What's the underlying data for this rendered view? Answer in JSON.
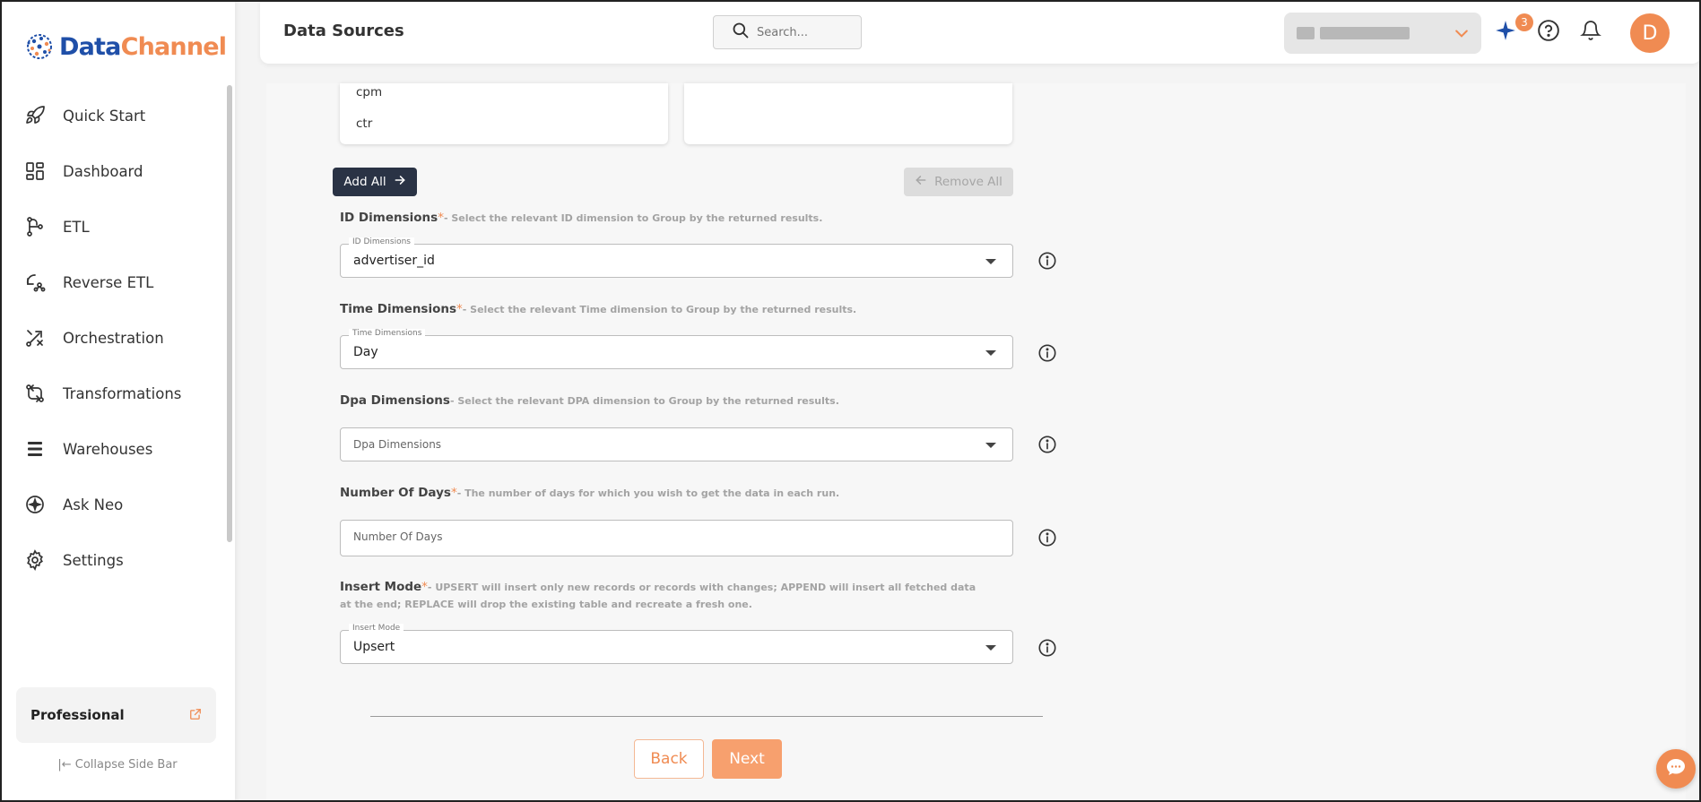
{
  "app": {
    "logo_part1": "Data",
    "logo_part2": "Channel",
    "brand_blue": "#1f4fa8",
    "accent": "#f08b52"
  },
  "sidebar": {
    "items": [
      {
        "label": "Quick Start",
        "icon": "rocket-icon"
      },
      {
        "label": "Dashboard",
        "icon": "dashboard-icon"
      },
      {
        "label": "ETL",
        "icon": "etl-icon"
      },
      {
        "label": "Reverse ETL",
        "icon": "reverse-etl-icon"
      },
      {
        "label": "Orchestration",
        "icon": "orchestration-icon"
      },
      {
        "label": "Transformations",
        "icon": "transformations-icon"
      },
      {
        "label": "Warehouses",
        "icon": "warehouses-icon"
      },
      {
        "label": "Ask Neo",
        "icon": "sparkle-icon"
      },
      {
        "label": "Settings",
        "icon": "gear-icon"
      }
    ],
    "plan_label": "Professional",
    "collapse_label": "Collapse Side Bar"
  },
  "header": {
    "title": "Data Sources",
    "search_placeholder": "Search...",
    "notifications_badge": "3",
    "avatar_initial": "D"
  },
  "metrics_list": {
    "available": [
      "cpm",
      "ctr"
    ]
  },
  "buttons": {
    "add_all": "Add All",
    "remove_all": "Remove All",
    "back": "Back",
    "next": "Next"
  },
  "fields": {
    "id_dimensions": {
      "title": "ID Dimensions",
      "required": "*",
      "hint": "- Select the relevant ID dimension to Group by the returned results.",
      "float_label": "ID Dimensions",
      "value": "advertiser_id"
    },
    "time_dimensions": {
      "title": "Time Dimensions",
      "required": "*",
      "hint": "- Select the relevant Time dimension to Group by the returned results.",
      "float_label": "Time Dimensions",
      "value": "Day"
    },
    "dpa_dimensions": {
      "title": "Dpa Dimensions",
      "hint": "- Select the relevant DPA dimension to Group by the returned results.",
      "placeholder": "Dpa Dimensions"
    },
    "number_of_days": {
      "title": "Number Of Days",
      "required": "*",
      "hint": "- The number of days for which you wish to get the data in each run.",
      "placeholder": "Number Of Days"
    },
    "insert_mode": {
      "title": "Insert Mode",
      "required": "*",
      "hint": "- UPSERT will insert only new records or records with changes; APPEND will insert all fetched data at the end; REPLACE will drop the existing table and recreate a fresh one.",
      "float_label": "Insert Mode",
      "value": "Upsert"
    }
  }
}
